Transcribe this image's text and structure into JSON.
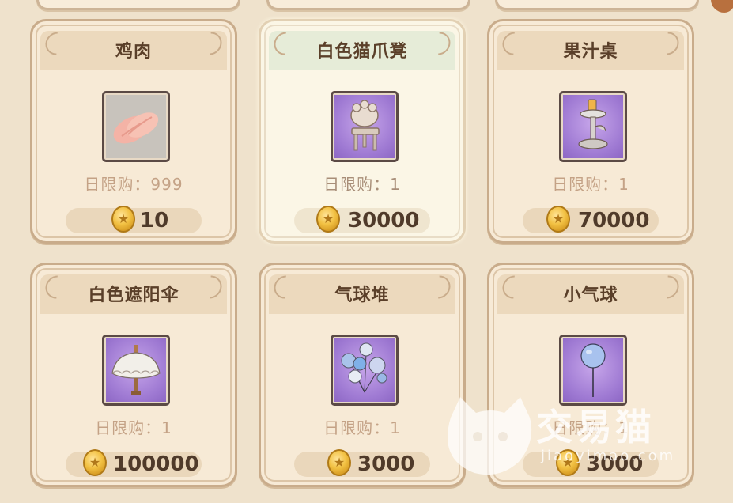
{
  "shop": {
    "currency_icon": "gold-star-coin-icon",
    "items": [
      {
        "name": "鸡肉",
        "limit": "日限购：999",
        "price": "10",
        "icon": "raw-chicken-icon",
        "frame": "grey"
      },
      {
        "name": "白色猫爪凳",
        "limit": "日限购：1",
        "price": "30000",
        "icon": "cat-paw-chair-icon",
        "frame": "purple",
        "selected": true
      },
      {
        "name": "果汁桌",
        "limit": "日限购：1",
        "price": "70000",
        "icon": "juice-table-icon",
        "frame": "purple"
      },
      {
        "name": "白色遮阳伞",
        "limit": "日限购：1",
        "price": "100000",
        "icon": "white-parasol-icon",
        "frame": "purple"
      },
      {
        "name": "气球堆",
        "limit": "日限购：1",
        "price": "3000",
        "icon": "balloon-pile-icon",
        "frame": "purple"
      },
      {
        "name": "小气球",
        "limit": "日限购：1",
        "price": "3000",
        "icon": "small-balloon-icon",
        "frame": "purple"
      }
    ]
  },
  "watermark": {
    "text": "交易猫",
    "url": "jiaoyimao.com"
  }
}
